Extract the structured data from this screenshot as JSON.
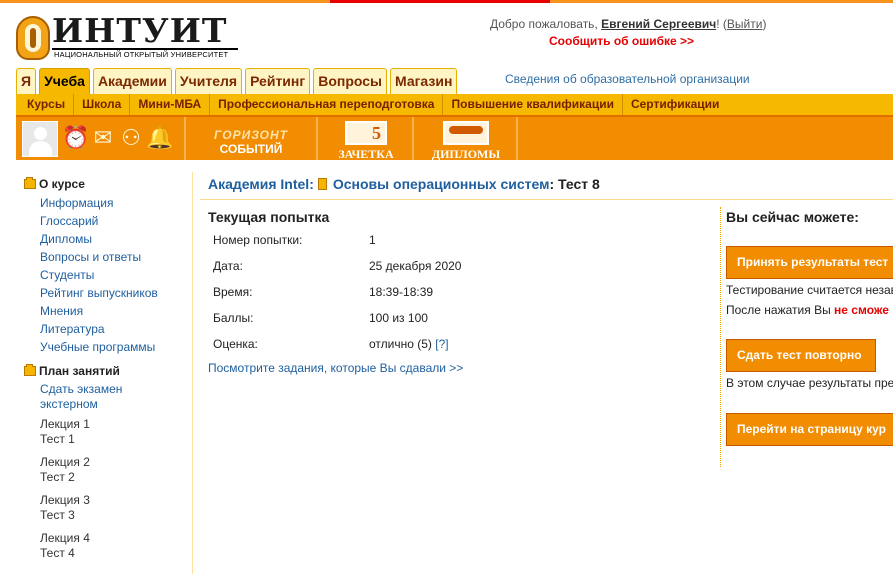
{
  "header": {
    "logo_word": "ИНТУИТ",
    "logo_sub": "Национальный открытый университет",
    "welcome_prefix": "Добро пожаловать, ",
    "user_name": "Евгений Сергеевич",
    "welcome_mid": "! (",
    "logout": "Выйти",
    "welcome_suffix": ")",
    "report_error": "Сообщить об ошибке >>"
  },
  "main_tabs": [
    {
      "label": "Я"
    },
    {
      "label": "Учеба"
    },
    {
      "label": "Академии"
    },
    {
      "label": "Учителя"
    },
    {
      "label": "Рейтинг"
    },
    {
      "label": "Вопросы"
    },
    {
      "label": "Магазин"
    }
  ],
  "org_info": "Сведения об образовательной организации",
  "sub_nav": [
    {
      "label": "Курсы"
    },
    {
      "label": "Школа"
    },
    {
      "label": "Мини-МБА"
    },
    {
      "label": "Профессиональная переподготовка"
    },
    {
      "label": "Повышение квалификации"
    },
    {
      "label": "Сертификации"
    }
  ],
  "toolbar": {
    "horizon_line1": "ГОРИЗОНТ",
    "horizon_line2": "СОБЫТИЙ",
    "zachetka_badge": "5",
    "zachetka": "ЗАЧЕТКА",
    "diplomy": "ДИПЛОМЫ",
    "icons": [
      "avatar",
      "alarm-clock-icon",
      "envelope-icon",
      "people-icon",
      "bell-icon"
    ]
  },
  "sidebar": {
    "about_heading": "О курсе",
    "about_items": [
      {
        "label": "Информация"
      },
      {
        "label": "Глоссарий"
      },
      {
        "label": "Дипломы"
      },
      {
        "label": "Вопросы и ответы"
      },
      {
        "label": "Студенты"
      },
      {
        "label": "Рейтинг выпускников"
      },
      {
        "label": "Мнения"
      },
      {
        "label": "Литература"
      },
      {
        "label": "Учебные программы"
      }
    ],
    "plan_heading": "План занятий",
    "exam_line1": "Сдать экзамен",
    "exam_line2": "экстерном",
    "lectures": [
      {
        "lecture": "Лекция 1",
        "test": "Тест 1"
      },
      {
        "lecture": "Лекция 2",
        "test": "Тест 2"
      },
      {
        "lecture": "Лекция 3",
        "test": "Тест 3"
      },
      {
        "lecture": "Лекция 4",
        "test": "Тест 4"
      }
    ]
  },
  "breadcrumb": {
    "academy": "Академия Intel",
    "colon1": ":",
    "course": "Основы операционных систем",
    "colon2": ":",
    "test": "Тест 8"
  },
  "attempt": {
    "title": "Текущая попытка",
    "rows": [
      {
        "key": "Номер попытки:",
        "value": "1"
      },
      {
        "key": "Дата:",
        "value": "25 декабря 2020"
      },
      {
        "key": "Время:",
        "value": "18:39-18:39"
      },
      {
        "key": "Баллы:",
        "value": "100 из 100"
      },
      {
        "key": "Оценка:",
        "value": "отлично (5)"
      }
    ],
    "help": "[?]",
    "view_tasks": "Посмотрите задания, которые Вы сдавали >>"
  },
  "right_panel": {
    "title": "Вы сейчас можете:",
    "accept_button": "Принять результаты тест",
    "accept_note": "Тестирование считается незав",
    "after_press_prefix": "После нажатия Вы ",
    "after_press_red": "не сможе",
    "retake_button": "Сдать тест повторно",
    "retake_note": "В этом случае результаты пре",
    "course_button": "Перейти на страницу кур"
  }
}
